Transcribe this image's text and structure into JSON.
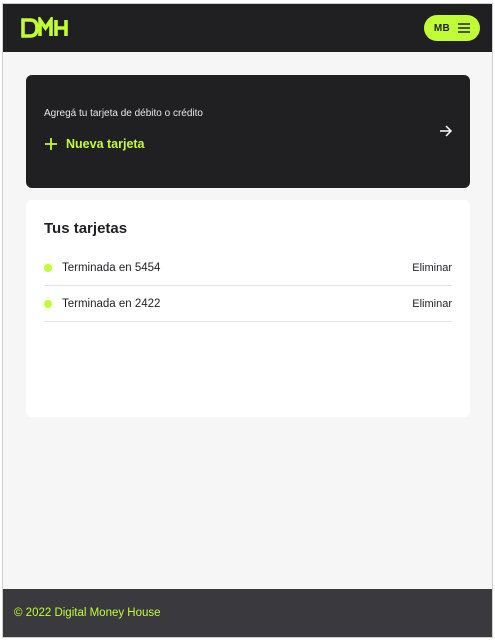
{
  "header": {
    "logo_icon": "dmh-logo",
    "user_initials": "MB",
    "menu_icon": "hamburger-menu-icon",
    "accent_color": "#c1fd35",
    "background_color": "#201f22"
  },
  "add_card": {
    "prompt": "Agregá tu tarjeta de débito o crédito",
    "new_card_label": "Nueva tarjeta",
    "plus_icon": "plus-icon",
    "arrow_icon": "arrow-right-icon"
  },
  "cards": {
    "title": "Tus tarjetas",
    "items": [
      {
        "label": "Terminada en 5454",
        "action": "Eliminar"
      },
      {
        "label": "Terminada en 2422",
        "action": "Eliminar"
      }
    ]
  },
  "footer": {
    "copyright": "© 2022 Digital Money House"
  }
}
